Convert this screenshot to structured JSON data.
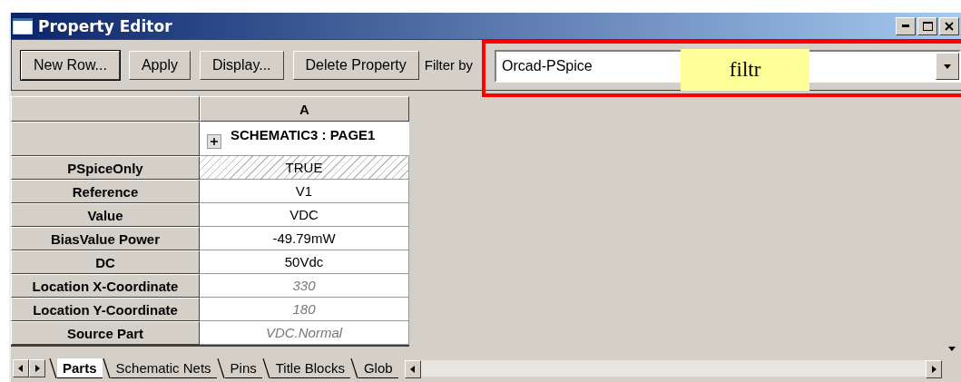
{
  "window": {
    "title": "Property Editor"
  },
  "toolbar": {
    "buttons": [
      "New Row...",
      "Apply",
      "Display...",
      "Delete Property"
    ],
    "filter_label": "Filter by",
    "filter_value": "Orcad-PSpice"
  },
  "annotation": {
    "note": "filtr"
  },
  "grid": {
    "column": "A",
    "group": "SCHEMATIC3 : PAGE1",
    "group_expanded": false,
    "rows": [
      {
        "label": "PSpiceOnly",
        "value": "TRUE",
        "kind": "readonly"
      },
      {
        "label": "Reference",
        "value": "V1",
        "kind": "normal"
      },
      {
        "label": "Value",
        "value": "VDC",
        "kind": "normal"
      },
      {
        "label": "BiasValue Power",
        "value": "-49.79mW",
        "kind": "normal"
      },
      {
        "label": "DC",
        "value": "50Vdc",
        "kind": "normal"
      },
      {
        "label": "Location X-Coordinate",
        "value": "330",
        "kind": "default"
      },
      {
        "label": "Location Y-Coordinate",
        "value": "180",
        "kind": "default"
      },
      {
        "label": "Source Part",
        "value": "VDC.Normal",
        "kind": "default"
      }
    ]
  },
  "tabs": [
    {
      "label": "Parts",
      "selected": true
    },
    {
      "label": "Schematic Nets",
      "selected": false
    },
    {
      "label": "Pins",
      "selected": false
    },
    {
      "label": "Title Blocks",
      "selected": false
    },
    {
      "label": "Glob",
      "selected": false
    }
  ]
}
